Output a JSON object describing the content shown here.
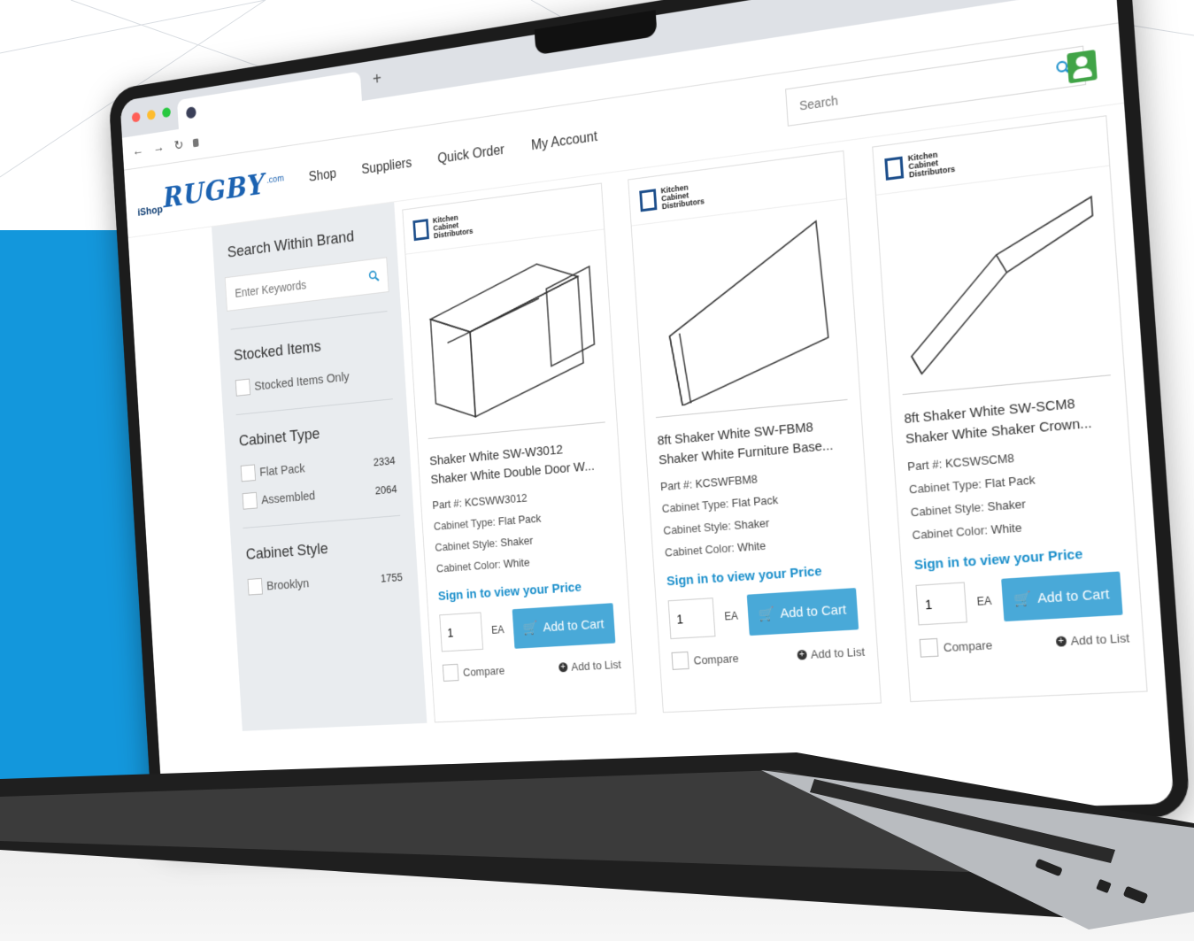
{
  "colors": {
    "accent_blue": "#1397dc",
    "brand_blue": "#1b62b1",
    "button_blue": "#49a9d8",
    "price_link": "#1b8fcb",
    "account_green": "#41a447"
  },
  "site": {
    "logo_prefix": "iShop",
    "logo_name": "RUGBY",
    "logo_suffix": ".com",
    "nav": [
      "Shop",
      "Suppliers",
      "Quick Order",
      "My Account"
    ],
    "search_placeholder": "Search"
  },
  "sidebar": {
    "brand_search_title": "Search Within Brand",
    "keyword_placeholder": "Enter Keywords",
    "stocked_title": "Stocked Items",
    "stocked_option": "Stocked Items Only",
    "cabinet_type_title": "Cabinet Type",
    "cabinet_types": [
      {
        "label": "Flat Pack",
        "count": "2334"
      },
      {
        "label": "Assembled",
        "count": "2064"
      }
    ],
    "cabinet_style_title": "Cabinet Style",
    "cabinet_styles": [
      {
        "label": "Brooklyn",
        "count": "1755"
      }
    ]
  },
  "products": [
    {
      "brand": [
        "Kitchen",
        "Cabinet",
        "Distributors"
      ],
      "title_line1": "Shaker White SW-W3012",
      "title_line2": "Shaker White Double Door W...",
      "part": "Part #:  KCSWW3012",
      "type_label": "Cabinet Type:",
      "type": "Flat Pack",
      "style_label": "Cabinet Style:",
      "style": "Shaker",
      "color_label": "Cabinet Color:",
      "color": "White",
      "price_link": "Sign in to view your Price",
      "qty": "1",
      "uom": "EA",
      "cart": "Add to Cart",
      "compare": "Compare",
      "add_list": "Add to List"
    },
    {
      "brand": [
        "Kitchen",
        "Cabinet",
        "Distributors"
      ],
      "title_line1": "8ft Shaker White SW-FBM8",
      "title_line2": "Shaker White Furniture Base...",
      "part": "Part #:  KCSWFBM8",
      "type_label": "Cabinet Type:",
      "type": "Flat Pack",
      "style_label": "Cabinet Style:",
      "style": "Shaker",
      "color_label": "Cabinet Color:",
      "color": "White",
      "price_link": "Sign in to view your Price",
      "qty": "1",
      "uom": "EA",
      "cart": "Add to Cart",
      "compare": "Compare",
      "add_list": "Add to List"
    },
    {
      "brand": [
        "Kitchen",
        "Cabinet",
        "Distributors"
      ],
      "title_line1": "8ft Shaker White SW-SCM8",
      "title_line2": "Shaker White Shaker Crown...",
      "part": "Part #:  KCSWSCM8",
      "type_label": "Cabinet Type:",
      "type": "Flat Pack",
      "style_label": "Cabinet Style:",
      "style": "Shaker",
      "color_label": "Cabinet Color:",
      "color": "White",
      "price_link": "Sign in to view your Price",
      "qty": "1",
      "uom": "EA",
      "cart": "Add to Cart",
      "compare": "Compare",
      "add_list": "Add to List"
    }
  ],
  "icons": {
    "search": "search-icon",
    "cart": "cart-icon",
    "account": "account-icon",
    "add_list": "plus-circle-icon"
  }
}
